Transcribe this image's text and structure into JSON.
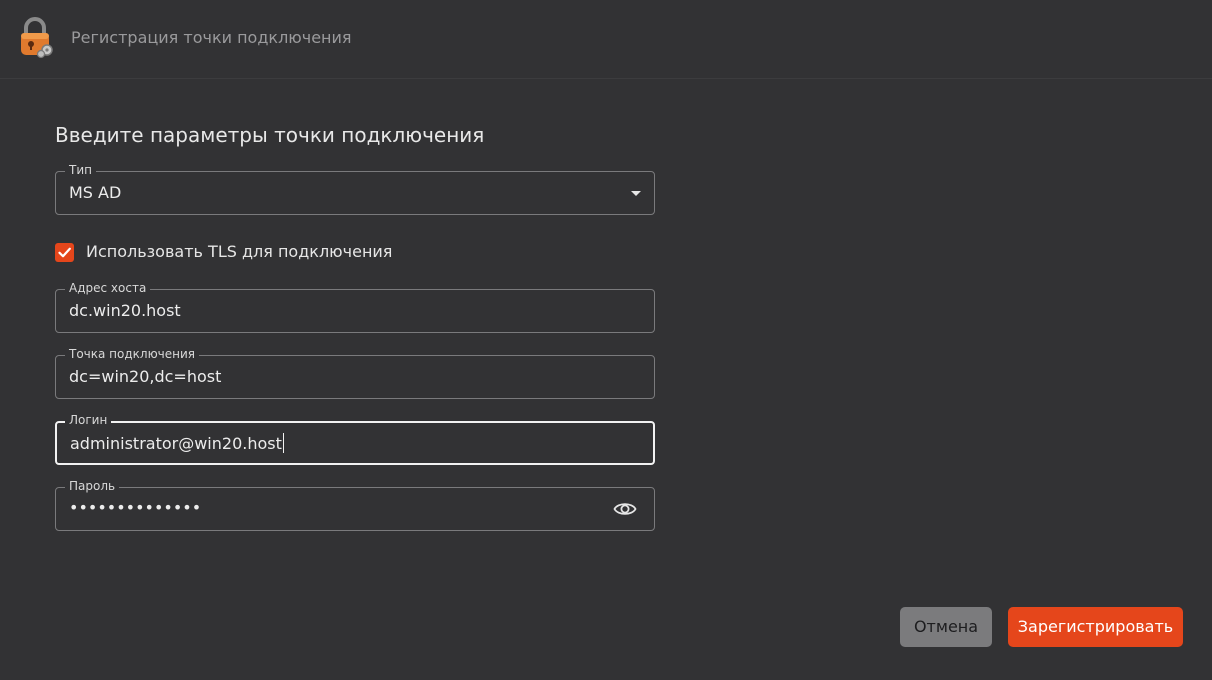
{
  "header": {
    "title": "Регистрация точки подключения",
    "logo_icon": "padlock-logo-icon"
  },
  "form": {
    "section_title": "Введите параметры точки подключения",
    "type": {
      "label": "Тип",
      "value": "MS AD"
    },
    "tls": {
      "label": "Использовать TLS для подключения",
      "checked": true
    },
    "host": {
      "label": "Адрес хоста",
      "value": "dc.win20.host"
    },
    "connection_point": {
      "label": "Точка подключения",
      "value": "dc=win20,dc=host"
    },
    "login": {
      "label": "Логин",
      "value": "administrator@win20.host"
    },
    "password": {
      "label": "Пароль",
      "masked_value": "••••••••••••••",
      "visibility_icon": "eye-icon"
    }
  },
  "actions": {
    "cancel_label": "Отмена",
    "register_label": "Зарегистрировать"
  },
  "colors": {
    "accent": "#e5461b",
    "background": "#323234",
    "cancel_button": "#7b7b7d"
  }
}
